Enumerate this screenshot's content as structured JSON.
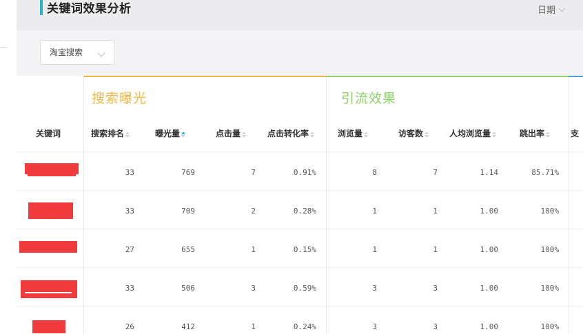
{
  "header": {
    "title": "关键词效果分析",
    "date_label": "日期"
  },
  "filter": {
    "source_value": "淘宝搜索"
  },
  "groups": {
    "search": "搜索曝光",
    "traffic": "引流效果"
  },
  "columns": {
    "keyword": "关键词",
    "rank": "搜索排名",
    "impressions": "曝光量",
    "clicks": "点击量",
    "ctr": "点击转化率",
    "views": "浏览量",
    "visitors": "访客数",
    "avg_views": "人均浏览量",
    "bounce": "跳出率",
    "pay_partial": "支"
  },
  "sort": {
    "active_column": "impressions",
    "direction": "desc"
  },
  "colors": {
    "accent": "#26b5c8",
    "search_group": "#f2b84b",
    "traffic_group": "#8fd06a",
    "redaction": "#f03c3c"
  },
  "rows": [
    {
      "rank": "33",
      "impressions": "769",
      "clicks": "7",
      "ctr": "0.91%",
      "views": "8",
      "visitors": "7",
      "avg_views": "1.14",
      "bounce": "85.71%"
    },
    {
      "rank": "33",
      "impressions": "709",
      "clicks": "2",
      "ctr": "0.28%",
      "views": "1",
      "visitors": "1",
      "avg_views": "1.00",
      "bounce": "100%"
    },
    {
      "rank": "27",
      "impressions": "655",
      "clicks": "1",
      "ctr": "0.15%",
      "views": "1",
      "visitors": "1",
      "avg_views": "1.00",
      "bounce": "100%"
    },
    {
      "rank": "33",
      "impressions": "506",
      "clicks": "3",
      "ctr": "0.59%",
      "views": "3",
      "visitors": "3",
      "avg_views": "1.00",
      "bounce": "100%"
    },
    {
      "rank": "26",
      "impressions": "412",
      "clicks": "1",
      "ctr": "0.24%",
      "views": "3",
      "visitors": "3",
      "avg_views": "1.00",
      "bounce": "100%"
    }
  ]
}
